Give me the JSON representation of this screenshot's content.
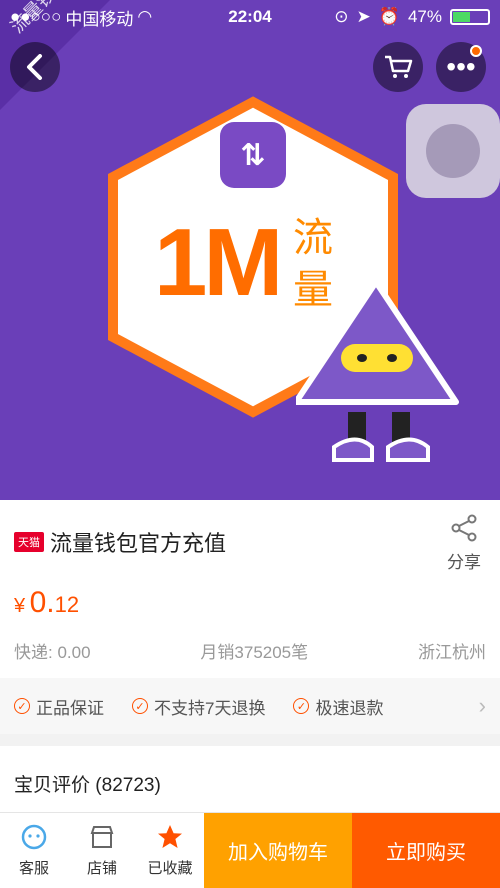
{
  "status": {
    "carrier": "中国移动",
    "time": "22:04",
    "battery": "47%",
    "battery_level": 0.47
  },
  "hero": {
    "ribbon": "流量钱包 充值",
    "badge_big": "1M",
    "badge_side": "流量",
    "colors": {
      "bg": "#6a3fb8",
      "accent": "#ff6d00"
    }
  },
  "nav": {
    "back_icon": "chevron-left-icon",
    "cart_icon": "cart-icon",
    "more_icon": "more-dots-icon"
  },
  "product": {
    "store_badge": "天猫",
    "title": "流量钱包官方充值",
    "share_label": "分享",
    "price": {
      "currency": "¥",
      "integer": "0.",
      "decimal": "12"
    },
    "shipping": "快递: 0.00",
    "sales": "月销375205笔",
    "location": "浙江杭州",
    "guarantees": [
      "正品保证",
      "不支持7天退换",
      "极速退款"
    ],
    "review_title": "宝贝评价",
    "review_count": "(82723)"
  },
  "bottom": {
    "tabs": [
      {
        "label": "客服",
        "icon": "customer-service-icon"
      },
      {
        "label": "店铺",
        "icon": "store-icon"
      },
      {
        "label": "已收藏",
        "icon": "star-icon"
      }
    ],
    "add_cart": "加入购物车",
    "buy_now": "立即购买"
  }
}
